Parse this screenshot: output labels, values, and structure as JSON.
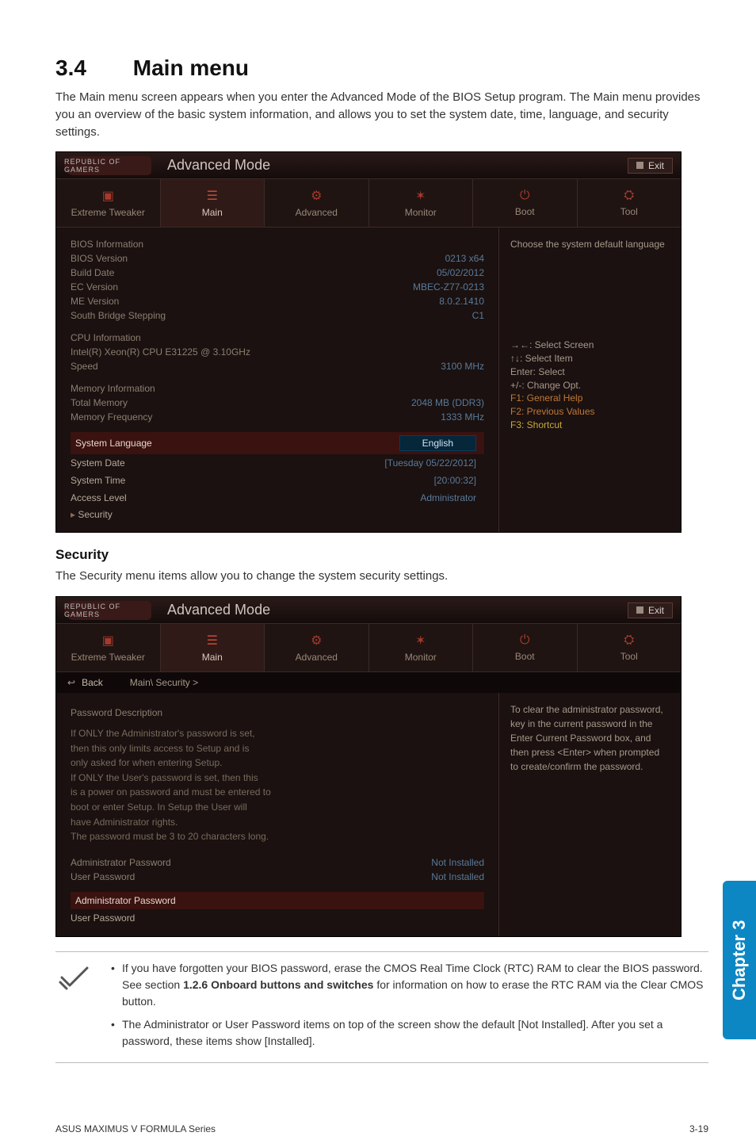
{
  "heading": {
    "number": "3.4",
    "title": "Main menu"
  },
  "intro": "The Main menu screen appears when you enter the Advanced Mode of the BIOS Setup program. The Main menu provides you an overview of the basic system information, and allows you to set the system date, time, language, and security settings.",
  "bios_common": {
    "badge": "REPUBLIC OF\nGAMERS",
    "mode": "Advanced Mode",
    "exit": "Exit"
  },
  "tabs": [
    {
      "label": "Extreme Tweaker",
      "icon": "▣"
    },
    {
      "label": "Main",
      "icon": "☰",
      "active": true
    },
    {
      "label": "Advanced",
      "icon": "⚙"
    },
    {
      "label": "Monitor",
      "icon": "✶"
    },
    {
      "label": "Boot",
      "icon": "⏻"
    },
    {
      "label": "Tool",
      "icon": "⛭"
    }
  ],
  "main_screen": {
    "info": [
      {
        "label": "BIOS Information",
        "val": ""
      },
      {
        "label": "BIOS Version",
        "val": "0213 x64"
      },
      {
        "label": "Build Date",
        "val": "05/02/2012"
      },
      {
        "label": "EC Version",
        "val": "MBEC-Z77-0213"
      },
      {
        "label": "ME Version",
        "val": "8.0.2.1410"
      },
      {
        "label": "South Bridge Stepping",
        "val": "C1"
      }
    ],
    "cpu": [
      {
        "label": "CPU Information",
        "val": ""
      },
      {
        "label": "Intel(R) Xeon(R) CPU E31225 @ 3.10GHz",
        "val": ""
      },
      {
        "label": "Speed",
        "val": "3100 MHz"
      }
    ],
    "mem": [
      {
        "label": "Memory Information",
        "val": ""
      },
      {
        "label": "Total Memory",
        "val": "2048 MB (DDR3)"
      },
      {
        "label": "Memory Frequency",
        "val": "1333 MHz"
      }
    ],
    "lang_row": {
      "label": "System Language",
      "value": "English"
    },
    "date_row": {
      "label": "System Date",
      "value": "[Tuesday 05/22/2012]"
    },
    "time_row": {
      "label": "System Time",
      "value": "[20:00:32]"
    },
    "access": {
      "label": "Access Level",
      "value": "Administrator"
    },
    "security_sub": "Security",
    "help": "Choose the system default language",
    "keys": [
      "→←: Select Screen",
      "↑↓: Select Item",
      "Enter: Select",
      "+/-: Change Opt.",
      "F1: General Help",
      "F2: Previous Values",
      "F3: Shortcut"
    ]
  },
  "security_heading": "Security",
  "security_intro": "The Security menu items allow you to change the system security settings.",
  "security_screen": {
    "breadcrumb_back": "Back",
    "breadcrumb_path": "Main\\ Security >",
    "desc_title": "Password Description",
    "desc_lines": [
      "If ONLY the Administrator's password is set,",
      "then this only limits access to Setup and is",
      "only asked for when entering Setup.",
      "If ONLY the User's password is set, then this",
      "is a power on password and must be entered to",
      "boot or enter Setup. In Setup the User will",
      "have Administrator rights.",
      "The password must be 3 to 20 characters long."
    ],
    "admin_pw_label": "Administrator Password",
    "admin_pw_val": "Not Installed",
    "user_pw_label": "User Password",
    "user_pw_val": "Not Installed",
    "admin_pw_item": "Administrator Password",
    "user_pw_item": "User Password",
    "help": "To clear the administrator password, key in the current password in the Enter Current Password box, and then press <Enter> when prompted to create/confirm the password."
  },
  "note": {
    "b1a": "If you have forgotten your BIOS password, erase the CMOS Real Time Clock (RTC) RAM to clear the BIOS password. See section ",
    "b1bold": "1.2.6 Onboard buttons and switches",
    "b1b": " for information on how to erase the RTC RAM via the Clear CMOS button.",
    "b2": "The Administrator or User Password items on top of the screen show the default [Not Installed]. After you set a password, these items show [Installed]."
  },
  "side_tab": "Chapter 3",
  "footer_left": "ASUS MAXIMUS V FORMULA Series",
  "footer_right": "3-19"
}
